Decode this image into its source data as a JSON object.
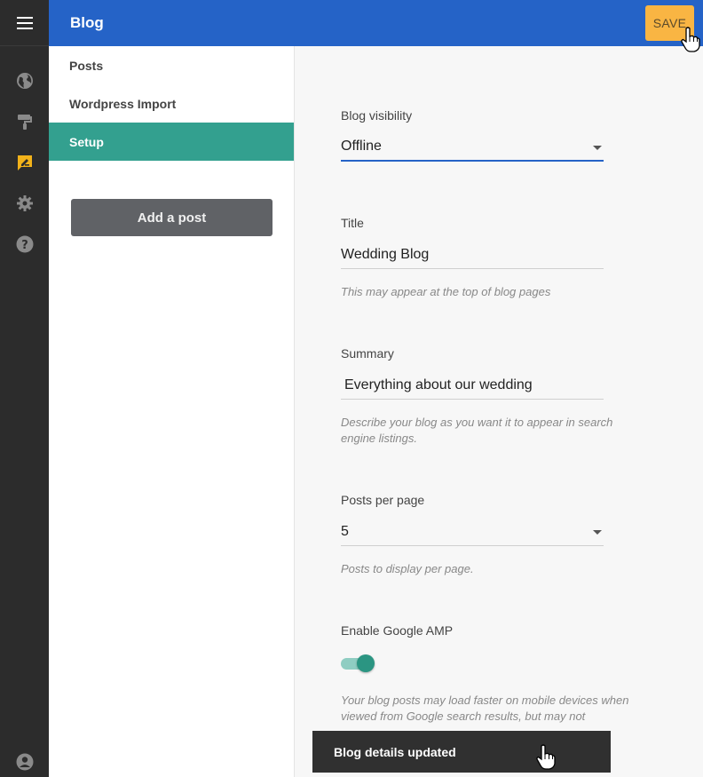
{
  "header": {
    "title": "Blog",
    "save_label": "SAVE"
  },
  "rail": {
    "icons": [
      "menu-icon",
      "globe-icon",
      "paint-roller-icon",
      "blog-edit-icon",
      "gear-icon",
      "help-icon",
      "account-icon"
    ],
    "active_color": "#f2b21a"
  },
  "subnav": {
    "items": [
      {
        "label": "Posts"
      },
      {
        "label": "Wordpress Import"
      },
      {
        "label": "Setup"
      }
    ],
    "add_post_label": "Add a post"
  },
  "form": {
    "visibility": {
      "label": "Blog visibility",
      "value": "Offline"
    },
    "title": {
      "label": "Title",
      "value": "Wedding Blog",
      "hint": "This may appear at the top of blog pages"
    },
    "summary": {
      "label": "Summary",
      "value": "Everything about our wedding",
      "hint": "Describe your blog as you want it to appear in search engine listings."
    },
    "posts_per_page": {
      "label": "Posts per page",
      "value": "5",
      "hint": "Posts to display per page."
    },
    "amp": {
      "label": "Enable Google AMP",
      "enabled": true,
      "hint": "Your blog posts may load faster on mobile devices when viewed from Google search results, but may not"
    }
  },
  "snackbar": {
    "message": "Blog details updated"
  },
  "colors": {
    "header": "#2563c7",
    "accent": "#33a08f",
    "save": "#f9b543",
    "rail": "#2c2c2c"
  }
}
